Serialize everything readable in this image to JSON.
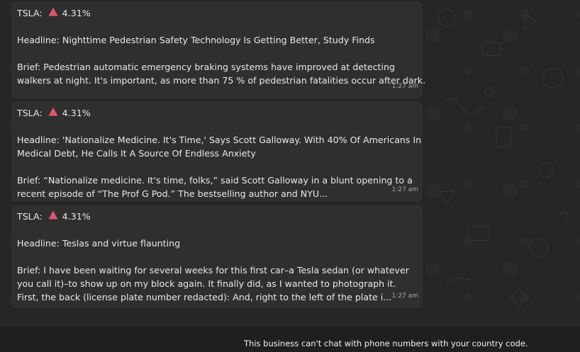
{
  "messages": [
    {
      "ticker_label": "TSLA:",
      "change": "4.31%",
      "change_icon": "red-up-triangle",
      "headline": "Headline: Nighttime Pedestrian Safety Technology Is Getting Better, Study Finds",
      "brief_lines": [
        "Brief: Pedestrian automatic emergency braking systems have improved at detecting",
        "walkers at night. It's important, as more than 75 % of pedestrian fatalities occur after dark."
      ],
      "time": "1:27 am"
    },
    {
      "ticker_label": "TSLA:",
      "change": "4.31%",
      "change_icon": "red-up-triangle",
      "headline_lines": [
        "Headline: 'Nationalize Medicine. It's Time,' Says Scott Galloway. With 40% Of Americans In",
        "Medical Debt, He Calls It A Source Of Endless Anxiety"
      ],
      "brief_lines": [
        "Brief: “Nationalize medicine. It's time, folks,” said Scott Galloway in a blunt opening to a",
        "recent episode of “The Prof G Pod.” The bestselling author and NYU..."
      ],
      "time": "1:27 am"
    },
    {
      "ticker_label": "TSLA:",
      "change": "4.31%",
      "change_icon": "red-up-triangle",
      "headline": "Headline: Teslas and virtue flaunting",
      "brief_lines": [
        "Brief: I have been waiting for several weeks for this first car–a Tesla sedan (or whatever",
        "you call it)–to show up on my block again. It finally did, as I wanted to photograph it.",
        "First, the back (license plate number redacted): And, right to the left of the plate i..."
      ],
      "time": "1:27 am"
    }
  ],
  "footer": {
    "notice": "This business can't chat with phone numbers with your country code."
  },
  "colors": {
    "bubble": "#2f2f2f",
    "background": "#262626",
    "triangle": "#e0566c"
  }
}
